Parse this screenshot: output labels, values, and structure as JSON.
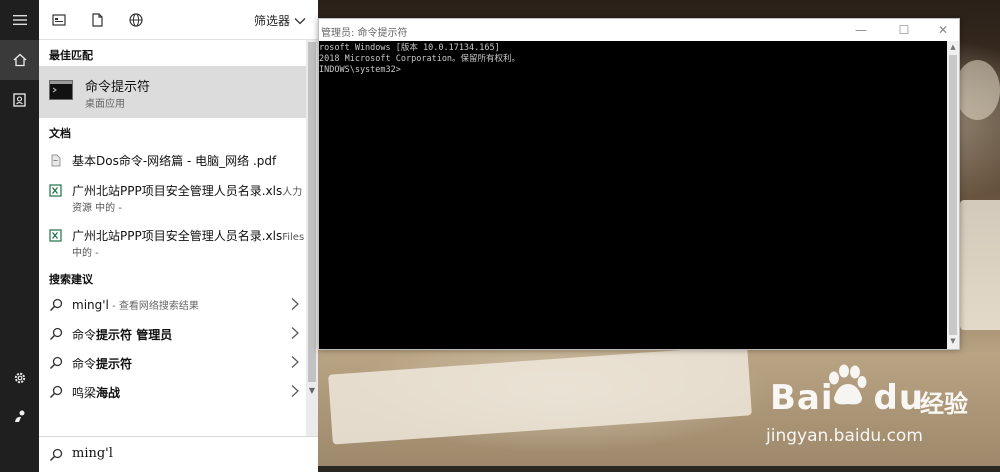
{
  "start_panel": {
    "toolbar": {
      "icons": [
        "apps-icon",
        "document-icon",
        "globe-icon"
      ],
      "filter_label": "筛选器"
    },
    "sections": {
      "best_match": "最佳匹配",
      "documents": "文档",
      "suggestions": "搜索建议"
    },
    "best_match": {
      "title": "命令提示符",
      "subtitle": "桌面应用"
    },
    "documents": [
      {
        "name": "基本Dos命令-网络篇 - 电脑_网络 .pdf",
        "location": "",
        "sub": ""
      },
      {
        "name": "广州北站PPP项目安全管理人员名录.xls",
        "location": "人力",
        "sub": "资源 中的 -"
      },
      {
        "name": "广州北站PPP项目安全管理人员名录.xls",
        "location": "Files",
        "sub": "中的 -"
      }
    ],
    "suggestions": [
      {
        "text": "ming'l",
        "bold": "",
        "hint": " - 查看网络搜索结果"
      },
      {
        "text": "命令",
        "bold": "提示符 管理员",
        "hint": ""
      },
      {
        "text": "命令",
        "bold": "提示符",
        "hint": ""
      },
      {
        "text": "鸣梁",
        "bold": "海战",
        "hint": ""
      }
    ],
    "search_query": "ming'l"
  },
  "cmd_window": {
    "title": "管理员: 命令提示符",
    "lines": [
      "rosoft Windows [版本 10.0.17134.165]",
      "2018 Microsoft Corporation。保留所有权利。",
      "",
      "INDOWS\\system32>"
    ]
  },
  "watermark": {
    "brand_latin": "Bai",
    "brand_latin_2": "du",
    "brand_cn": "经验",
    "url": "jingyan.baidu.com"
  }
}
